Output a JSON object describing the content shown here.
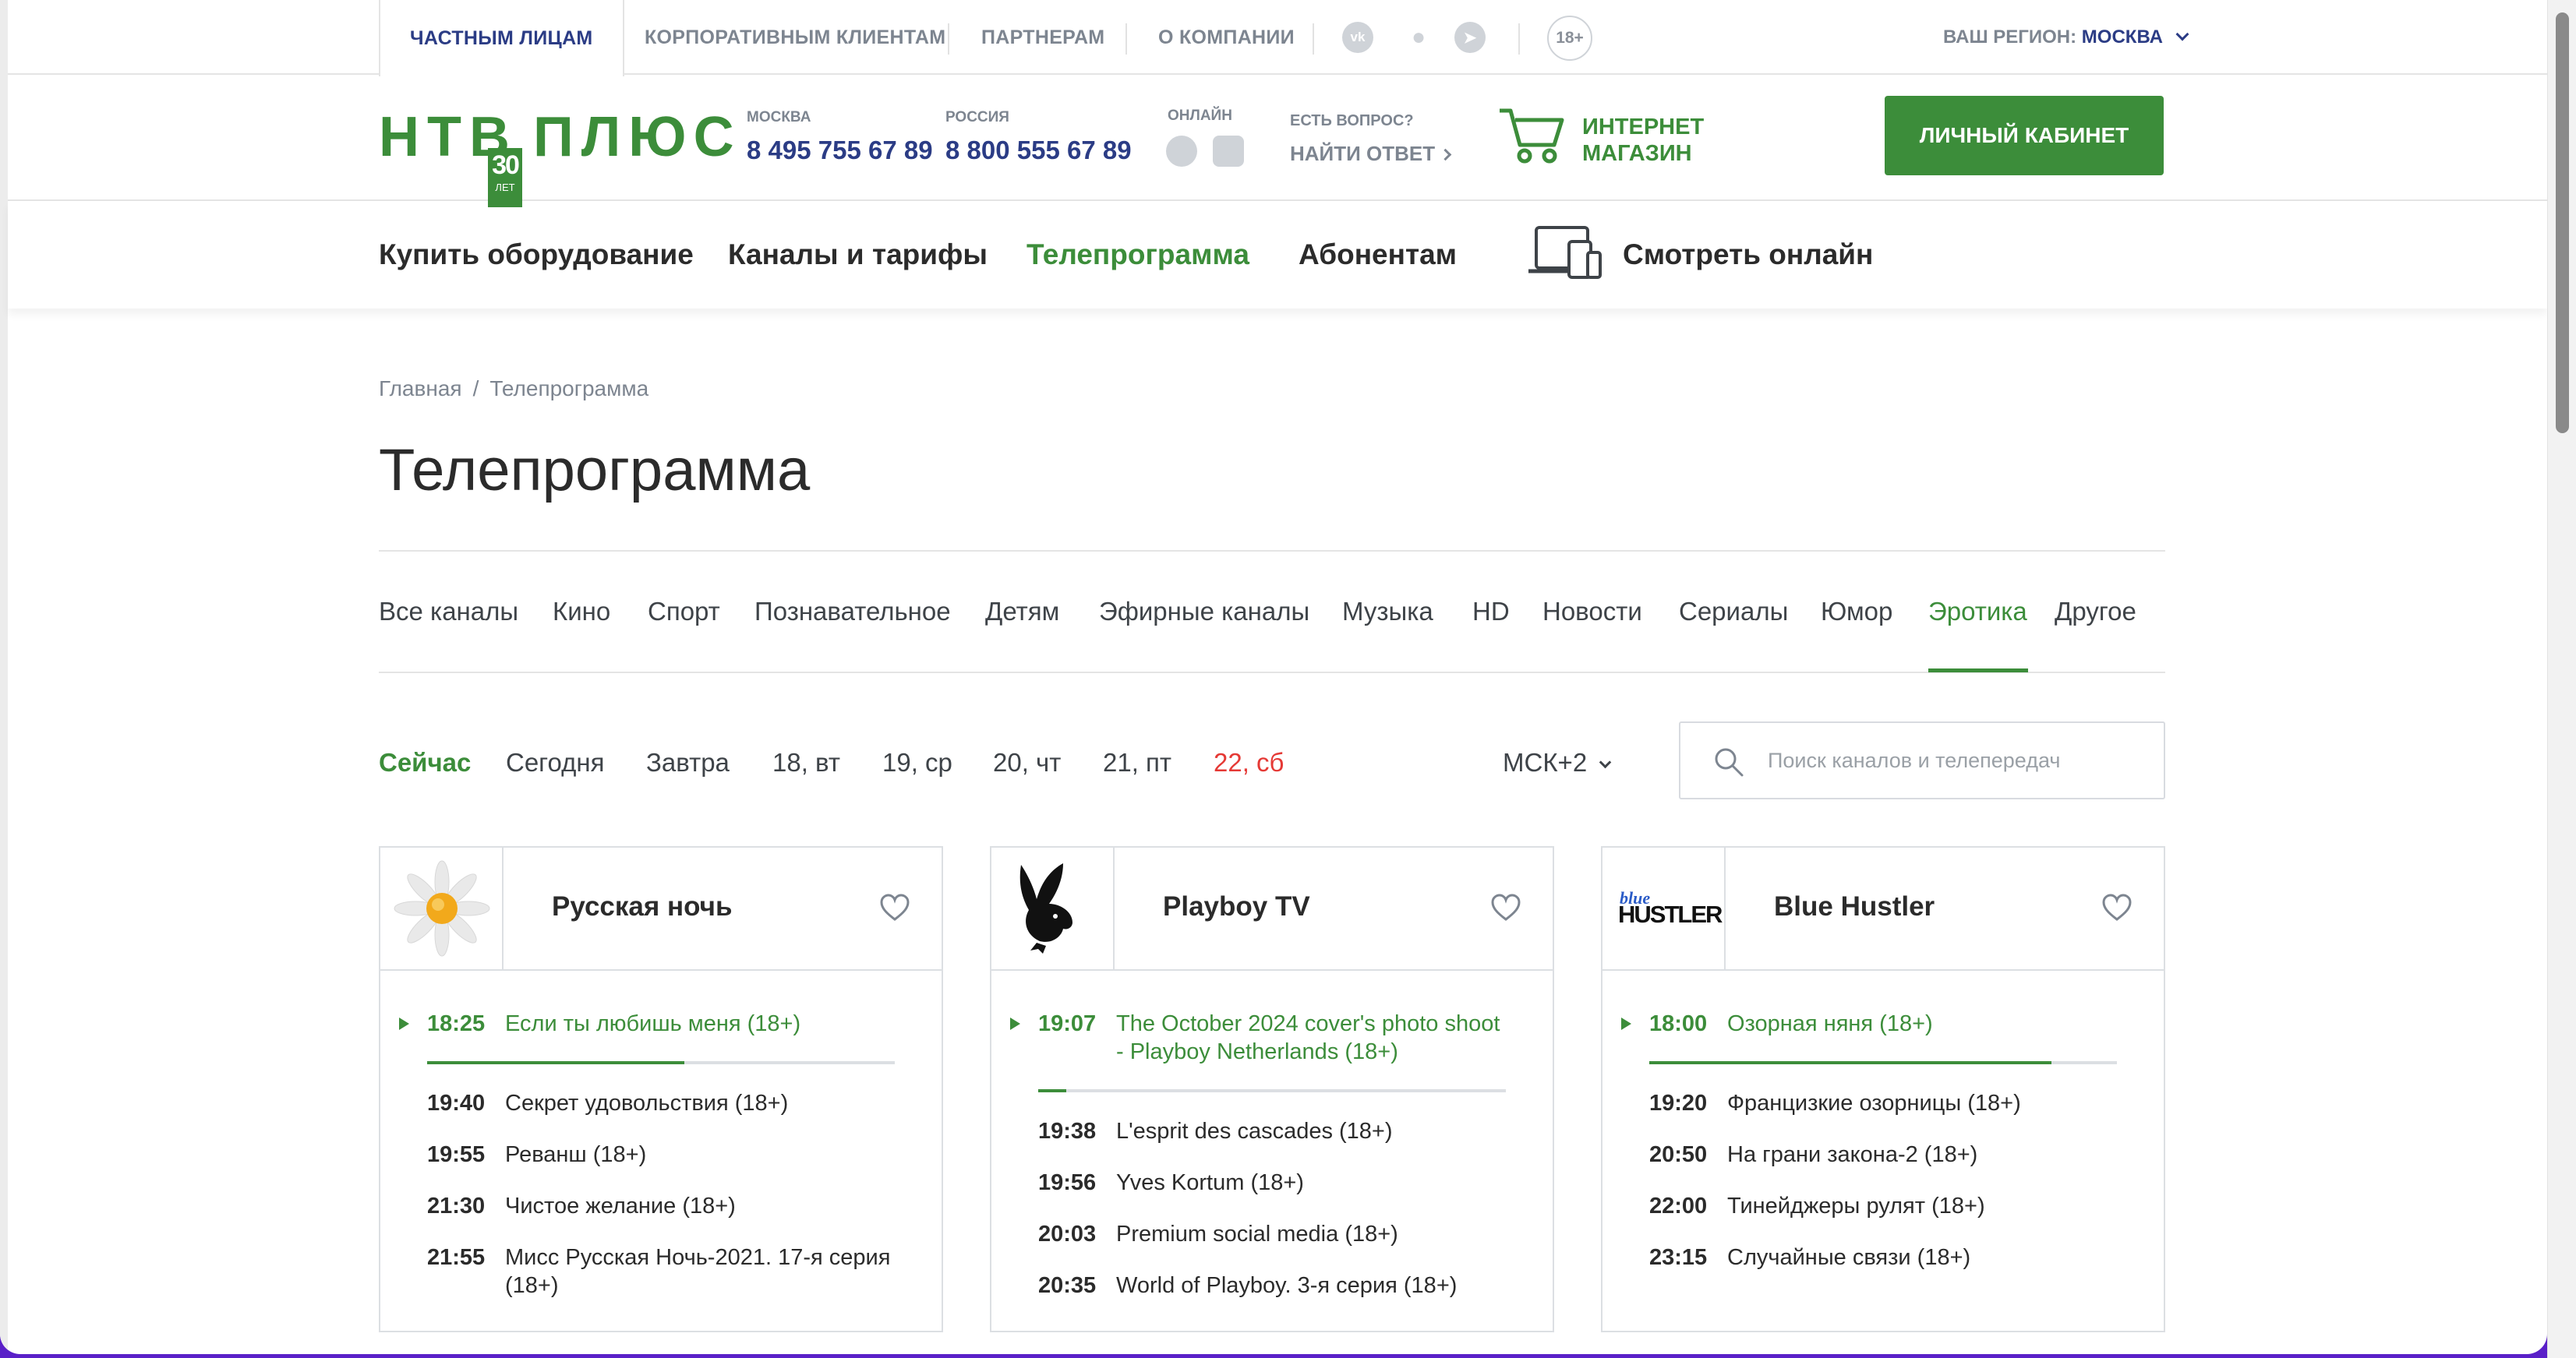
{
  "topbar": {
    "tabs": [
      "ЧАСТНЫМ ЛИЦАМ",
      "КОРПОРАТИВНЫМ КЛИЕНТАМ",
      "ПАРТНЕРАМ",
      "О КОМПАНИИ"
    ],
    "age_badge": "18+",
    "region_label": "ВАШ РЕГИОН:",
    "region_value": "МОСКВА"
  },
  "header": {
    "logo_left": "НТВ",
    "logo_right": "ПЛЮС",
    "logo_years": "30",
    "logo_years_label": "ЛЕТ",
    "moscow_label": "МОСКВА",
    "moscow_phone": "8 495 755 67 89",
    "russia_label": "РОССИЯ",
    "russia_phone": "8 800 555 67 89",
    "online_label": "ОНЛАЙН",
    "question_label": "ЕСТЬ ВОПРОС?",
    "find_answer": "НАЙТИ ОТВЕТ",
    "shop_line1": "ИНТЕРНЕТ",
    "shop_line2": "МАГАЗИН",
    "cabinet": "ЛИЧНЫЙ КАБИНЕТ"
  },
  "nav": {
    "items": [
      "Купить оборудование",
      "Каналы и тарифы",
      "Телепрограмма",
      "Абонентам"
    ],
    "watch_online": "Смотреть онлайн",
    "active": "Телепрограмма"
  },
  "breadcrumb": {
    "home": "Главная",
    "separator": "/",
    "current": "Телепрограмма"
  },
  "page_title": "Телепрограмма",
  "categories": {
    "items": [
      "Все каналы",
      "Кино",
      "Спорт",
      "Познавательное",
      "Детям",
      "Эфирные каналы",
      "Музыка",
      "HD",
      "Новости",
      "Сериалы",
      "Юмор",
      "Эротика",
      "Другое"
    ],
    "active": "Эротика"
  },
  "days": {
    "items": [
      "Сейчас",
      "Сегодня",
      "Завтра",
      "18, вт",
      "19, ср",
      "20, чт",
      "21, пт",
      "22, сб"
    ],
    "active": "Сейчас",
    "weekend": "22, сб"
  },
  "timezone": "МСК+2",
  "search": {
    "placeholder": "Поиск каналов и телепередач",
    "value": ""
  },
  "colors": {
    "brand_green": "#3c8d3a",
    "brand_blue": "#2b3c85",
    "weekend_red": "#e53935"
  },
  "channels": [
    {
      "name": "Русская ночь",
      "logo_icon": "daisy-icon",
      "current": {
        "time": "18:25",
        "title": "Если ты любишь меня (18+)",
        "progress": 0.55
      },
      "upcoming": [
        {
          "time": "19:40",
          "title": "Секрет удовольствия (18+)"
        },
        {
          "time": "19:55",
          "title": "Реванш (18+)"
        },
        {
          "time": "21:30",
          "title": "Чистое желание (18+)"
        },
        {
          "time": "21:55",
          "title": "Мисс Русская Ночь-2021. 17-я серия (18+)"
        }
      ]
    },
    {
      "name": "Playboy TV",
      "logo_icon": "playboy-bunny-icon",
      "current": {
        "time": "19:07",
        "title": "The October 2024 cover's photo shoot - Playboy Netherlands (18+)",
        "progress": 0.06
      },
      "upcoming": [
        {
          "time": "19:38",
          "title": "L'esprit des cascades (18+)"
        },
        {
          "time": "19:56",
          "title": "Yves Kortum (18+)"
        },
        {
          "time": "20:03",
          "title": "Premium social media (18+)"
        },
        {
          "time": "20:35",
          "title": "World of Playboy. 3-я серия (18+)"
        }
      ]
    },
    {
      "name": "Blue Hustler",
      "logo_icon": "blue-hustler-logo",
      "logo_text_top": "blue",
      "logo_text_bottom": "HUSTLER",
      "current": {
        "time": "18:00",
        "title": "Озорная няня (18+)",
        "progress": 0.86
      },
      "upcoming": [
        {
          "time": "19:20",
          "title": "Францизкие озорницы (18+)"
        },
        {
          "time": "20:50",
          "title": "На грани закона-2 (18+)"
        },
        {
          "time": "22:00",
          "title": "Тинейджеры рулят (18+)"
        },
        {
          "time": "23:15",
          "title": "Случайные связи (18+)"
        }
      ]
    }
  ]
}
